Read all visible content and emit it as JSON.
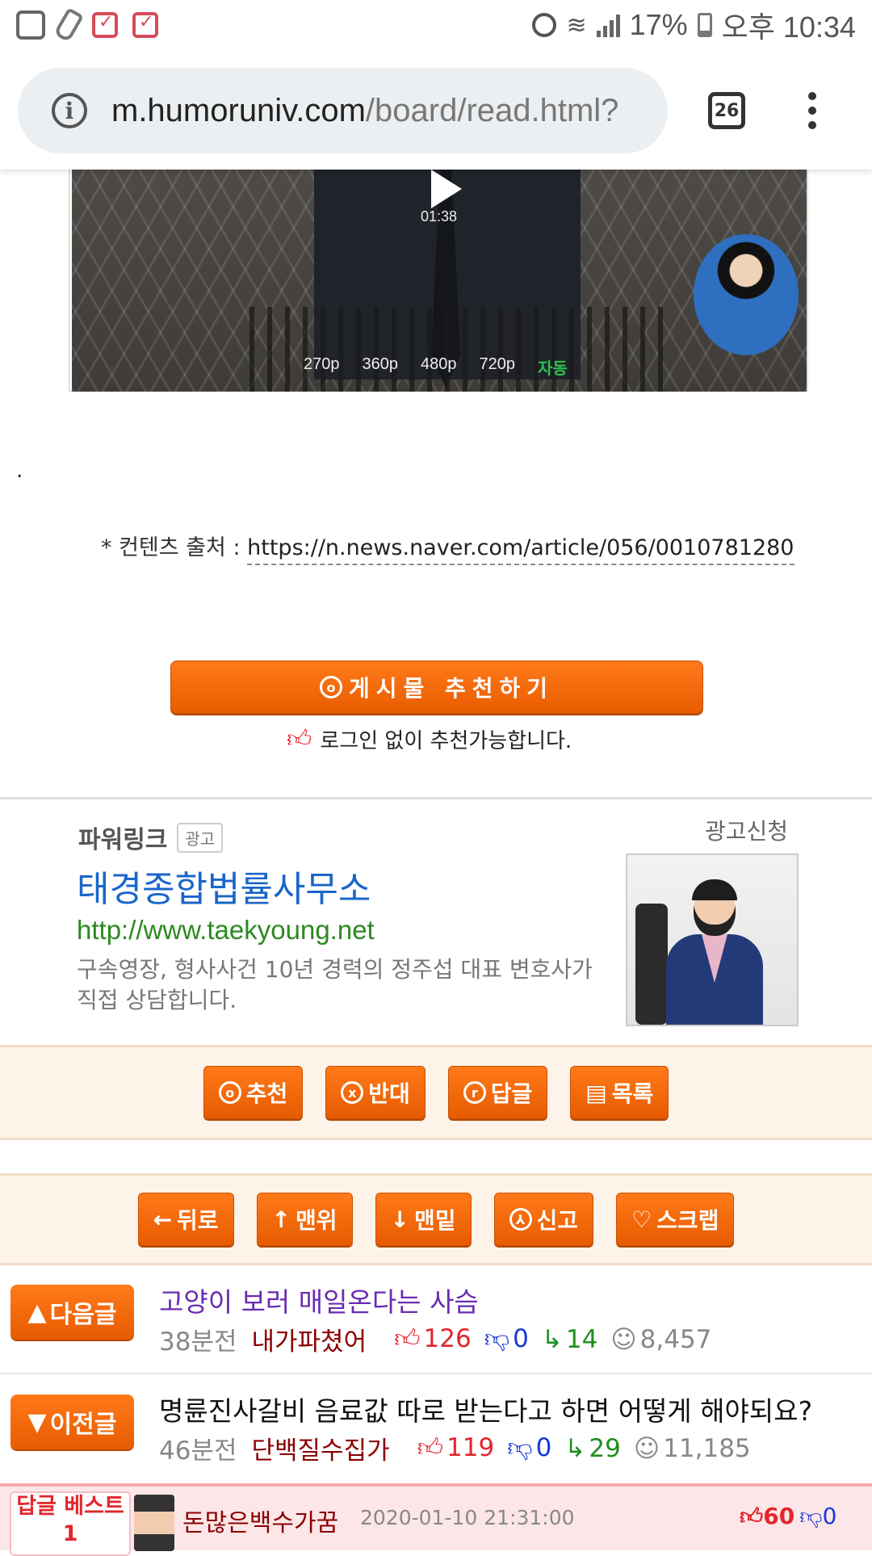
{
  "status_bar": {
    "battery": "17%",
    "time": "오후 10:34",
    "icons": [
      "uplus-icon",
      "baby-bottle-icon",
      "calendar-check-icon",
      "calendar-check-icon",
      "alarm-icon",
      "wifi-icon",
      "signal-icon",
      "battery-icon"
    ]
  },
  "browser": {
    "url_host": "m.humoruniv.com",
    "url_path": "/board/read.html?",
    "tab_count": "26"
  },
  "video": {
    "duration": "01:38",
    "qualities": [
      "270p",
      "360p",
      "480p",
      "720p"
    ],
    "auto_label": "자동"
  },
  "content": {
    "dot": ".",
    "source_label": "* 컨텐츠 출처 : ",
    "source_url": "https://n.news.naver.com/article/056/0010781280"
  },
  "recommend": {
    "button_label": "게시물  추천하기",
    "login_note": "로그인 없이 추천가능합니다."
  },
  "ad": {
    "label": "파워링크",
    "tag": "광고",
    "apply": "광고신청",
    "title": "태경종합법률사무소",
    "url": "http://www.taekyoung.net",
    "description": "구속영장, 형사사건 10년 경력의 정주섭 대표 변호사가 직접 상담합니다."
  },
  "action_bar": {
    "recommend": "추천",
    "oppose": "반대",
    "reply": "답글",
    "list": "목록"
  },
  "nav_bar": {
    "back": "뒤로",
    "top": "맨위",
    "bottom": "맨밑",
    "report": "신고",
    "scrap": "스크랩"
  },
  "next_post": {
    "badge": "다음글",
    "title": "고양이 보러 매일온다는 사슴",
    "time": "38분전",
    "author": "내가파쳤어",
    "likes": "126",
    "dislikes": "0",
    "replies": "14",
    "views": "8,457"
  },
  "prev_post": {
    "badge": "이전글",
    "title": "명륜진사갈비 음료값 따로 받는다고 하면 어떻게 해야되요?",
    "time": "46분전",
    "author": "단백질수집가",
    "likes": "119",
    "dislikes": "0",
    "replies": "29",
    "views": "11,185"
  },
  "best_reply": {
    "badge": "답글 베스트1",
    "user": "돈많은백수가꿈",
    "date": "2020-01-10 21:31:00",
    "likes": "60",
    "dislikes": "0"
  },
  "colors": {
    "accent_orange": "#e85c00",
    "link_blue": "#1a66c8",
    "url_green": "#2b8a1e",
    "like_red": "#e3262e",
    "dislike_blue": "#1a38d6",
    "reply_green": "#1f8f1f"
  }
}
